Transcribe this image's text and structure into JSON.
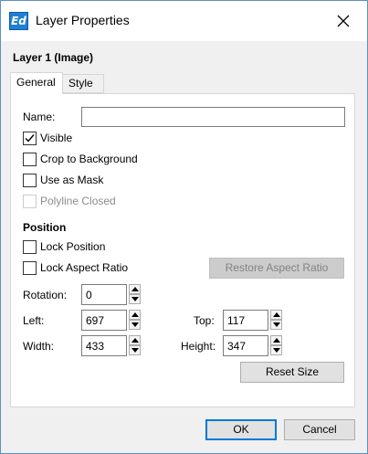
{
  "window": {
    "title": "Layer Properties",
    "app_icon_text": "Ed"
  },
  "layer_heading": "Layer 1 (Image)",
  "tabs": [
    {
      "label": "General",
      "selected": true
    },
    {
      "label": "Style",
      "selected": false
    }
  ],
  "general": {
    "name_label": "Name:",
    "name_value": "",
    "visible_label": "Visible",
    "visible_checked": true,
    "crop_label": "Crop to Background",
    "crop_checked": false,
    "mask_label": "Use as Mask",
    "mask_checked": false,
    "polyline_label": "Polyline Closed",
    "polyline_checked": false,
    "polyline_enabled": false
  },
  "position": {
    "heading": "Position",
    "lock_position_label": "Lock Position",
    "lock_position_checked": false,
    "lock_aspect_label": "Lock Aspect Ratio",
    "lock_aspect_checked": false,
    "restore_aspect_label": "Restore Aspect Ratio",
    "rotation_label": "Rotation:",
    "rotation_value": "0",
    "left_label": "Left:",
    "left_value": "697",
    "top_label": "Top:",
    "top_value": "117",
    "width_label": "Width:",
    "width_value": "433",
    "height_label": "Height:",
    "height_value": "347",
    "reset_size_label": "Reset Size"
  },
  "footer": {
    "ok_label": "OK",
    "cancel_label": "Cancel"
  },
  "colors": {
    "accent": "#0078d7",
    "window_border": "#5b8fc7",
    "icon_bg": "#1f7fd6"
  }
}
